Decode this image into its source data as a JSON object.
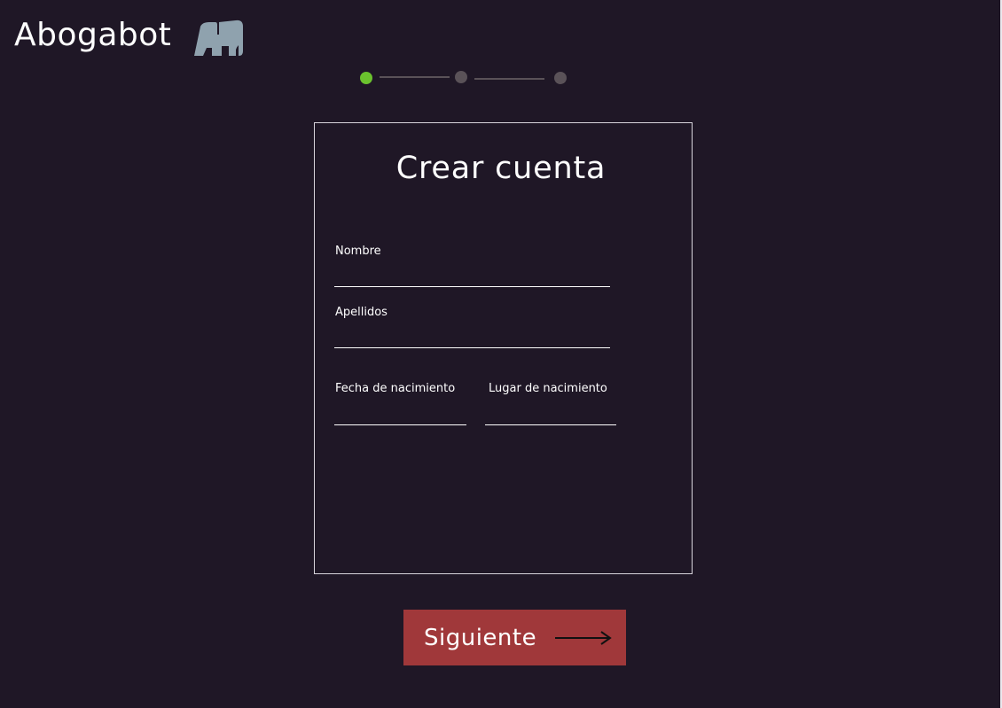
{
  "header": {
    "app_title": "Abogabot",
    "logo_icon": "elephant-icon",
    "logo_color": "#8fa2ae"
  },
  "stepper": {
    "current_step": 1,
    "total_steps": 3,
    "active_color": "#6bc22e",
    "inactive_color": "#5a5258"
  },
  "form": {
    "title": "Crear cuenta",
    "fields": {
      "nombre": {
        "label": "Nombre",
        "value": ""
      },
      "apellidos": {
        "label": "Apellidos",
        "value": ""
      },
      "fecha_nacimiento": {
        "label": "Fecha de nacimiento",
        "value": ""
      },
      "lugar_nacimiento": {
        "label": "Lugar de nacimiento",
        "value": ""
      }
    }
  },
  "actions": {
    "next_label": "Siguiente",
    "next_icon": "arrow-right-icon",
    "next_color": "#a0383a"
  },
  "theme": {
    "background": "#1f1726"
  }
}
